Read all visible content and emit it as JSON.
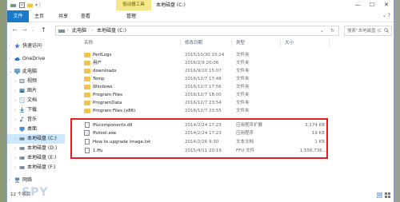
{
  "titlebar": {
    "context_tab": "驱动器工具",
    "title": "本地磁盘 (C:)",
    "minimize": "—",
    "maximize": "☐",
    "close": "✕"
  },
  "ribbon": {
    "tabs": [
      "文件",
      "主页",
      "共享",
      "查看",
      "管理"
    ],
    "expand": "⌄  ?"
  },
  "address": {
    "back": "←",
    "forward": "→",
    "up": "↑",
    "crumbs": [
      "此电脑",
      "本地磁盘 (C:)"
    ],
    "dropdown": "⌄",
    "refresh": "↻",
    "search_placeholder": "搜索\"本地磁盘 (C:)\""
  },
  "navpane": {
    "items": [
      {
        "label": "快速访问",
        "icon": "star-icon",
        "color": "#3a7bd5"
      },
      {
        "label": "OneDrive",
        "icon": "cloud-icon",
        "color": "#2a73c9"
      },
      {
        "label": "此电脑",
        "icon": "computer-icon",
        "color": "#6aa7d8"
      },
      {
        "label": "视频",
        "icon": "video-icon",
        "color": "#7a8a99"
      },
      {
        "label": "图片",
        "icon": "pictures-icon",
        "color": "#5f9fd6"
      },
      {
        "label": "文档",
        "icon": "documents-icon",
        "color": "#8f9ba8"
      },
      {
        "label": "下载",
        "icon": "download-icon",
        "color": "#2a7bd0"
      },
      {
        "label": "音乐",
        "icon": "music-icon",
        "color": "#3d7fc4"
      },
      {
        "label": "桌面",
        "icon": "desktop-icon",
        "color": "#4a8fd1"
      },
      {
        "label": "本地磁盘 (C:)",
        "icon": "drive-icon",
        "color": "#6d7f93"
      },
      {
        "label": "本地磁盘 (D:)",
        "icon": "drive-icon",
        "color": "#6d7f93"
      },
      {
        "label": "本地磁盘 (E:)",
        "icon": "drive-icon",
        "color": "#6d7f93"
      },
      {
        "label": "本地磁盘 (F:)",
        "icon": "drive-icon",
        "color": "#6d7f93"
      },
      {
        "label": "网络",
        "icon": "network-icon",
        "color": "#4a8fd1"
      }
    ]
  },
  "columns": {
    "name": "名称",
    "date": "修改日期",
    "type": "类型",
    "size": "大小"
  },
  "files": [
    {
      "name": "PerfLogs",
      "date": "2015/10/30 15:24",
      "type": "文件夹",
      "size": "",
      "kind": "folder"
    },
    {
      "name": "用户",
      "date": "2016/2/9 20:06",
      "type": "文件夹",
      "size": "",
      "kind": "folder"
    },
    {
      "name": "downloads",
      "date": "2016/9/10 15:07",
      "type": "文件夹",
      "size": "",
      "kind": "folder"
    },
    {
      "name": "Temp",
      "date": "2016/12/7 17:48",
      "type": "文件夹",
      "size": "",
      "kind": "folder"
    },
    {
      "name": "Windows",
      "date": "2016/12/7 17:56",
      "type": "文件夹",
      "size": "",
      "kind": "folder"
    },
    {
      "name": "Program Files",
      "date": "2016/12/7 18:00",
      "type": "文件夹",
      "size": "",
      "kind": "folder"
    },
    {
      "name": "ProgramData",
      "date": "2016/12/7 23:54",
      "type": "文件夹",
      "size": "",
      "kind": "folder"
    },
    {
      "name": "Program Files (x86)",
      "date": "2016/12/7 23:55",
      "type": "文件夹",
      "size": "",
      "kind": "folder"
    },
    {
      "name": "ffucomponents.dll",
      "date": "2014/2/24 17:23",
      "type": "应用程序扩展",
      "size": "3,174 KB",
      "kind": "dll"
    },
    {
      "name": "ffutool.exe",
      "date": "2014/2/24 17:23",
      "type": "应用程序",
      "size": "19 KB",
      "kind": "exe"
    },
    {
      "name": "How to upgrade image.txt",
      "date": "2014/2/26 9:30",
      "type": "文本文档",
      "size": "1 KB",
      "kind": "txt"
    },
    {
      "name": "1.ffu",
      "date": "2015/4/11 20:19",
      "type": "FFU 文件",
      "size": "1,556,736...",
      "kind": "ffu"
    }
  ],
  "status": {
    "count": "12 个项目"
  },
  "watermark": "SPY",
  "colors": {
    "accent": "#1979ca",
    "highlight_border": "#e02020",
    "folder": "#f2c54a",
    "selection": "#cce8ff"
  }
}
